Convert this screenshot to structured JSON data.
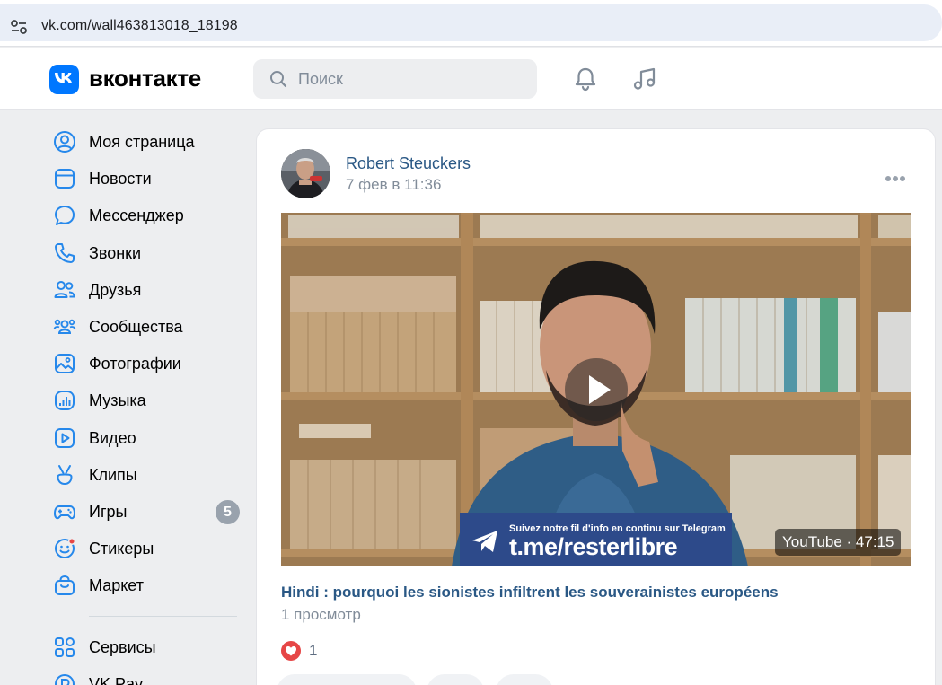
{
  "browser": {
    "url": "vk.com/wall463813018_18198"
  },
  "header": {
    "brand": "вконтакте",
    "search_placeholder": "Поиск"
  },
  "sidebar": {
    "items": [
      {
        "label": "Моя страница",
        "icon": "user-circle-icon"
      },
      {
        "label": "Новости",
        "icon": "news-icon"
      },
      {
        "label": "Мессенджер",
        "icon": "chat-bubble-icon"
      },
      {
        "label": "Звонки",
        "icon": "phone-icon"
      },
      {
        "label": "Друзья",
        "icon": "friends-icon"
      },
      {
        "label": "Сообщества",
        "icon": "communities-icon"
      },
      {
        "label": "Фотографии",
        "icon": "photo-icon"
      },
      {
        "label": "Музыка",
        "icon": "music-icon"
      },
      {
        "label": "Видео",
        "icon": "video-icon"
      },
      {
        "label": "Клипы",
        "icon": "clips-icon"
      },
      {
        "label": "Игры",
        "icon": "gamepad-icon",
        "badge": "5"
      },
      {
        "label": "Стикеры",
        "icon": "sticker-icon"
      },
      {
        "label": "Маркет",
        "icon": "market-bag-icon"
      }
    ],
    "bottom_items": [
      {
        "label": "Сервисы",
        "icon": "services-grid-icon"
      },
      {
        "label": "VK Pay",
        "icon": "vkpay-icon"
      }
    ]
  },
  "post": {
    "author": "Robert Steuckers",
    "date": "7 фев в 11:36",
    "video": {
      "banner_small": "Suivez notre fil d'info en continu sur Telegram",
      "banner_big": "t.me/resterlibre",
      "duration": "YouTube · 47:15"
    },
    "title": "Hindi : pourquoi les sionistes infiltrent les souverainistes européens",
    "views": "1 просмотр",
    "likes": "1"
  },
  "colors": {
    "accent": "#0077ff",
    "link": "#2a5885",
    "muted": "#818c99",
    "like": "#e64646"
  }
}
